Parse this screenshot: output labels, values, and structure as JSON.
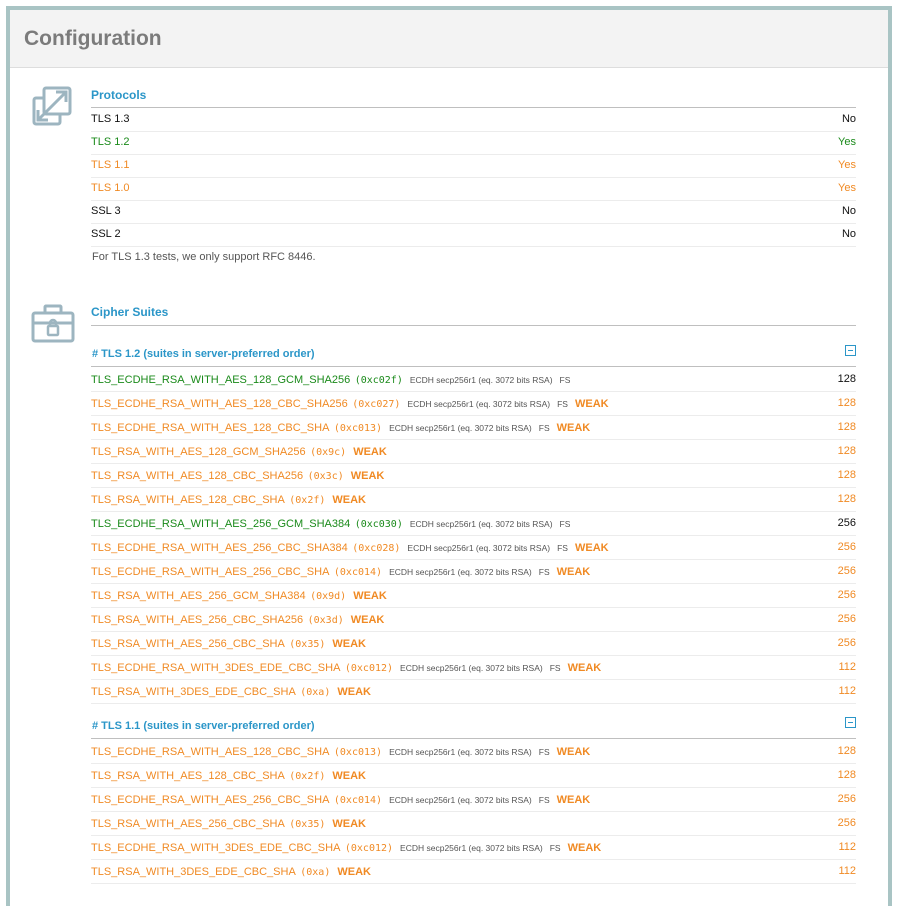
{
  "page_title": "Configuration",
  "protocols": {
    "title": "Protocols",
    "rows": [
      {
        "name": "TLS 1.3",
        "value": "No",
        "status": "black"
      },
      {
        "name": "TLS 1.2",
        "value": "Yes",
        "status": "green"
      },
      {
        "name": "TLS 1.1",
        "value": "Yes",
        "status": "orange"
      },
      {
        "name": "TLS 1.0",
        "value": "Yes",
        "status": "orange"
      },
      {
        "name": "SSL 3",
        "value": "No",
        "status": "black"
      },
      {
        "name": "SSL 2",
        "value": "No",
        "status": "black"
      }
    ],
    "note": "For TLS 1.3 tests, we only support RFC 8446."
  },
  "cipher_suites": {
    "title": "Cipher Suites",
    "groups": [
      {
        "title": "# TLS 1.2 (suites in server-preferred order)",
        "suites": [
          {
            "name": "TLS_ECDHE_RSA_WITH_AES_128_GCM_SHA256",
            "code": "(0xc02f)",
            "kx": "ECDH secp256r1 (eq. 3072 bits RSA)",
            "fs": "FS",
            "weak": "",
            "bits": "128",
            "status": "green"
          },
          {
            "name": "TLS_ECDHE_RSA_WITH_AES_128_CBC_SHA256",
            "code": "(0xc027)",
            "kx": "ECDH secp256r1 (eq. 3072 bits RSA)",
            "fs": "FS",
            "weak": "WEAK",
            "bits": "128",
            "status": "orange"
          },
          {
            "name": "TLS_ECDHE_RSA_WITH_AES_128_CBC_SHA",
            "code": "(0xc013)",
            "kx": "ECDH secp256r1 (eq. 3072 bits RSA)",
            "fs": "FS",
            "weak": "WEAK",
            "bits": "128",
            "status": "orange"
          },
          {
            "name": "TLS_RSA_WITH_AES_128_GCM_SHA256",
            "code": "(0x9c)",
            "kx": "",
            "fs": "",
            "weak": "WEAK",
            "bits": "128",
            "status": "orange"
          },
          {
            "name": "TLS_RSA_WITH_AES_128_CBC_SHA256",
            "code": "(0x3c)",
            "kx": "",
            "fs": "",
            "weak": "WEAK",
            "bits": "128",
            "status": "orange"
          },
          {
            "name": "TLS_RSA_WITH_AES_128_CBC_SHA",
            "code": "(0x2f)",
            "kx": "",
            "fs": "",
            "weak": "WEAK",
            "bits": "128",
            "status": "orange"
          },
          {
            "name": "TLS_ECDHE_RSA_WITH_AES_256_GCM_SHA384",
            "code": "(0xc030)",
            "kx": "ECDH secp256r1 (eq. 3072 bits RSA)",
            "fs": "FS",
            "weak": "",
            "bits": "256",
            "status": "green"
          },
          {
            "name": "TLS_ECDHE_RSA_WITH_AES_256_CBC_SHA384",
            "code": "(0xc028)",
            "kx": "ECDH secp256r1 (eq. 3072 bits RSA)",
            "fs": "FS",
            "weak": "WEAK",
            "bits": "256",
            "status": "orange"
          },
          {
            "name": "TLS_ECDHE_RSA_WITH_AES_256_CBC_SHA",
            "code": "(0xc014)",
            "kx": "ECDH secp256r1 (eq. 3072 bits RSA)",
            "fs": "FS",
            "weak": "WEAK",
            "bits": "256",
            "status": "orange"
          },
          {
            "name": "TLS_RSA_WITH_AES_256_GCM_SHA384",
            "code": "(0x9d)",
            "kx": "",
            "fs": "",
            "weak": "WEAK",
            "bits": "256",
            "status": "orange"
          },
          {
            "name": "TLS_RSA_WITH_AES_256_CBC_SHA256",
            "code": "(0x3d)",
            "kx": "",
            "fs": "",
            "weak": "WEAK",
            "bits": "256",
            "status": "orange"
          },
          {
            "name": "TLS_RSA_WITH_AES_256_CBC_SHA",
            "code": "(0x35)",
            "kx": "",
            "fs": "",
            "weak": "WEAK",
            "bits": "256",
            "status": "orange"
          },
          {
            "name": "TLS_ECDHE_RSA_WITH_3DES_EDE_CBC_SHA",
            "code": "(0xc012)",
            "kx": "ECDH secp256r1 (eq. 3072 bits RSA)",
            "fs": "FS",
            "weak": "WEAK",
            "bits": "112",
            "status": "orange"
          },
          {
            "name": "TLS_RSA_WITH_3DES_EDE_CBC_SHA",
            "code": "(0xa)",
            "kx": "",
            "fs": "",
            "weak": "WEAK",
            "bits": "112",
            "status": "orange"
          }
        ]
      },
      {
        "title": "# TLS 1.1 (suites in server-preferred order)",
        "suites": [
          {
            "name": "TLS_ECDHE_RSA_WITH_AES_128_CBC_SHA",
            "code": "(0xc013)",
            "kx": "ECDH secp256r1 (eq. 3072 bits RSA)",
            "fs": "FS",
            "weak": "WEAK",
            "bits": "128",
            "status": "orange"
          },
          {
            "name": "TLS_RSA_WITH_AES_128_CBC_SHA",
            "code": "(0x2f)",
            "kx": "",
            "fs": "",
            "weak": "WEAK",
            "bits": "128",
            "status": "orange"
          },
          {
            "name": "TLS_ECDHE_RSA_WITH_AES_256_CBC_SHA",
            "code": "(0xc014)",
            "kx": "ECDH secp256r1 (eq. 3072 bits RSA)",
            "fs": "FS",
            "weak": "WEAK",
            "bits": "256",
            "status": "orange"
          },
          {
            "name": "TLS_RSA_WITH_AES_256_CBC_SHA",
            "code": "(0x35)",
            "kx": "",
            "fs": "",
            "weak": "WEAK",
            "bits": "256",
            "status": "orange"
          },
          {
            "name": "TLS_ECDHE_RSA_WITH_3DES_EDE_CBC_SHA",
            "code": "(0xc012)",
            "kx": "ECDH secp256r1 (eq. 3072 bits RSA)",
            "fs": "FS",
            "weak": "WEAK",
            "bits": "112",
            "status": "orange"
          },
          {
            "name": "TLS_RSA_WITH_3DES_EDE_CBC_SHA",
            "code": "(0xa)",
            "kx": "",
            "fs": "",
            "weak": "WEAK",
            "bits": "112",
            "status": "orange"
          }
        ]
      }
    ]
  },
  "colors": {
    "green": "#1a8a1a",
    "orange": "#f08a24",
    "black": "#111111",
    "accent": "#2b96c8"
  },
  "icons": {
    "protocols": "expand-arrows-icon",
    "cipher_suites": "toolbox-lock-icon",
    "collapse": "collapse-minus-icon"
  }
}
